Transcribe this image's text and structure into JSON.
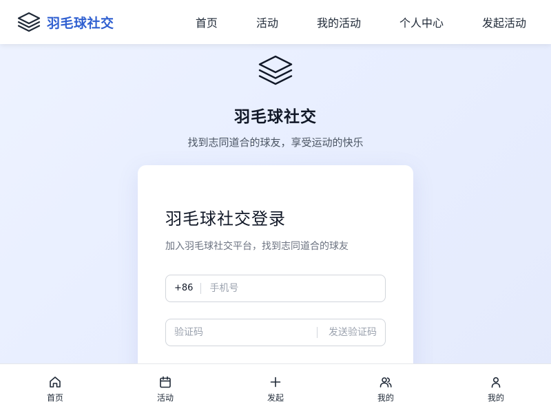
{
  "header": {
    "brand_name": "羽毛球社交",
    "logo_icon": "layers-icon",
    "nav": [
      {
        "label": "首页"
      },
      {
        "label": "活动"
      },
      {
        "label": "我的活动"
      },
      {
        "label": "个人中心"
      },
      {
        "label": "发起活动"
      }
    ]
  },
  "hero": {
    "logo_icon": "layers-icon",
    "title": "羽毛球社交",
    "subtitle": "找到志同道合的球友，享受运动的快乐"
  },
  "login": {
    "title": "羽毛球社交登录",
    "subtitle": "加入羽毛球社交平台，找到志同道合的球友",
    "phone": {
      "prefix": "+86",
      "placeholder": "手机号",
      "value": ""
    },
    "code": {
      "placeholder": "验证码",
      "value": "",
      "send_label": "发送验证码"
    }
  },
  "tabbar": [
    {
      "label": "首页",
      "icon": "home-icon"
    },
    {
      "label": "活动",
      "icon": "calendar-icon"
    },
    {
      "label": "发起",
      "icon": "plus-icon"
    },
    {
      "label": "我的",
      "icon": "users-icon"
    },
    {
      "label": "我的",
      "icon": "user-icon"
    }
  ],
  "colors": {
    "brand": "#2f5fd0",
    "background": "#eef3ff",
    "text": "#1f2937"
  }
}
